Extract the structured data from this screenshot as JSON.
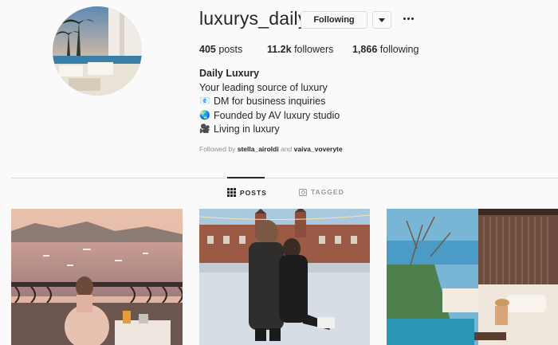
{
  "profile": {
    "username": "luxurys_daily",
    "following_label": "Following",
    "stats": {
      "posts_count": "405",
      "posts_label": "posts",
      "followers_count": "11.2k",
      "followers_label": "followers",
      "following_count": "1,866",
      "following_label": "following"
    },
    "bio": {
      "name": "Daily Luxury",
      "line1": "Your leading source of luxury",
      "line2_emoji": "📧",
      "line2": "DM for business inquiries",
      "line3_emoji": "🌏",
      "line3": "Founded by AV luxury studio",
      "line4_emoji": "🎥",
      "line4": "Living in luxury"
    },
    "followed_by": {
      "prefix": "Followed by",
      "user1": "stella_airoldi",
      "and": "and",
      "user2": "vaiva_voveryte"
    }
  },
  "tabs": {
    "posts": "POSTS",
    "tagged": "TAGGED"
  },
  "icons": [
    "grid-icon",
    "tag-icon",
    "caret-down-icon",
    "more-options-icon"
  ],
  "colors": {
    "background": "#fafafa",
    "text": "#262626",
    "muted": "#8e8e8e",
    "border": "#dbdbdb"
  }
}
